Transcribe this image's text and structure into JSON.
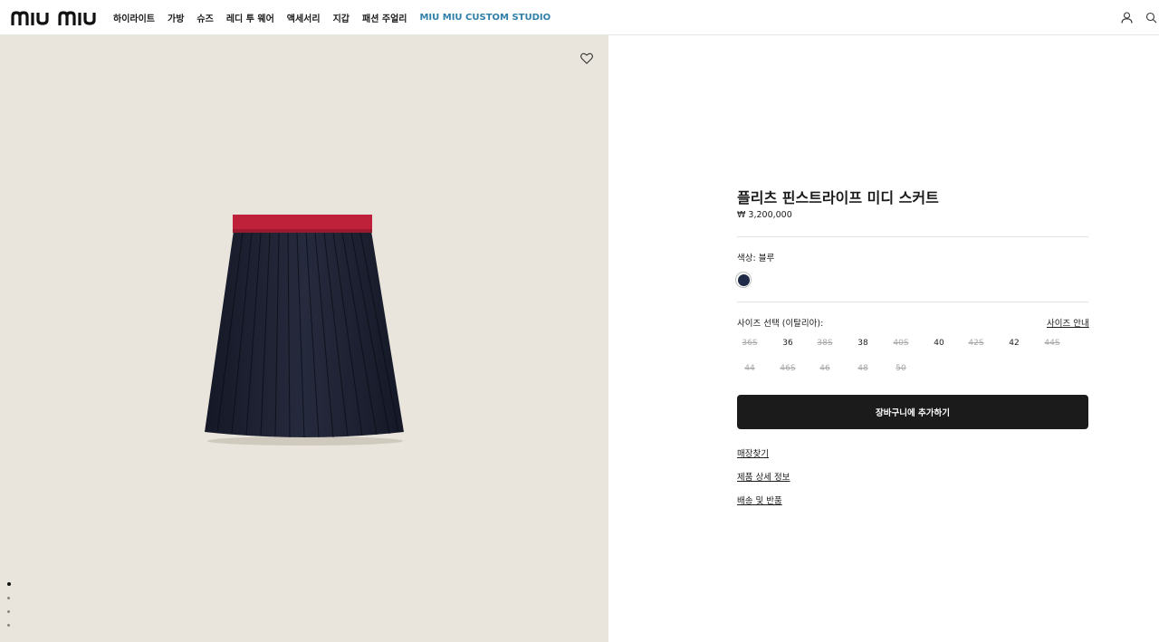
{
  "header": {
    "logo_text": "MIU MIU",
    "nav": [
      "하이라이트",
      "가방",
      "슈즈",
      "레디 투 웨어",
      "액세서리",
      "지갑",
      "패션 주얼리",
      "MIU MIU CUSTOM STUDIO"
    ],
    "icons": [
      "user-icon",
      "search-icon"
    ]
  },
  "product": {
    "title": "플리츠 핀스트라이프 미디 스커트",
    "price": "₩ 3,200,000",
    "color_label": "색상:  블루",
    "color_swatch": "#1f2b46",
    "size_label": "사이즈 선택 (이탈리아):",
    "size_guide": "사이즈 안내",
    "sizes": [
      {
        "label": "36S",
        "available": false
      },
      {
        "label": "36",
        "available": true
      },
      {
        "label": "38S",
        "available": false
      },
      {
        "label": "38",
        "available": true
      },
      {
        "label": "40S",
        "available": false
      },
      {
        "label": "40",
        "available": true
      },
      {
        "label": "42S",
        "available": false
      },
      {
        "label": "42",
        "available": true
      },
      {
        "label": "44S",
        "available": false
      },
      {
        "label": "44",
        "available": false
      },
      {
        "label": "46S",
        "available": false
      },
      {
        "label": "46",
        "available": false
      },
      {
        "label": "48",
        "available": false
      },
      {
        "label": "50",
        "available": false
      }
    ],
    "add_to_cart": "장바구니에 추가하기",
    "links": [
      "매장찾기",
      "제품 상세 정보",
      "배송 및 반품"
    ]
  },
  "gallery": {
    "slide_count": 4,
    "active_index": 0,
    "background": "#e9e5dd",
    "waistband_color": "#c0213a",
    "skirt_color": "#1e2233"
  }
}
